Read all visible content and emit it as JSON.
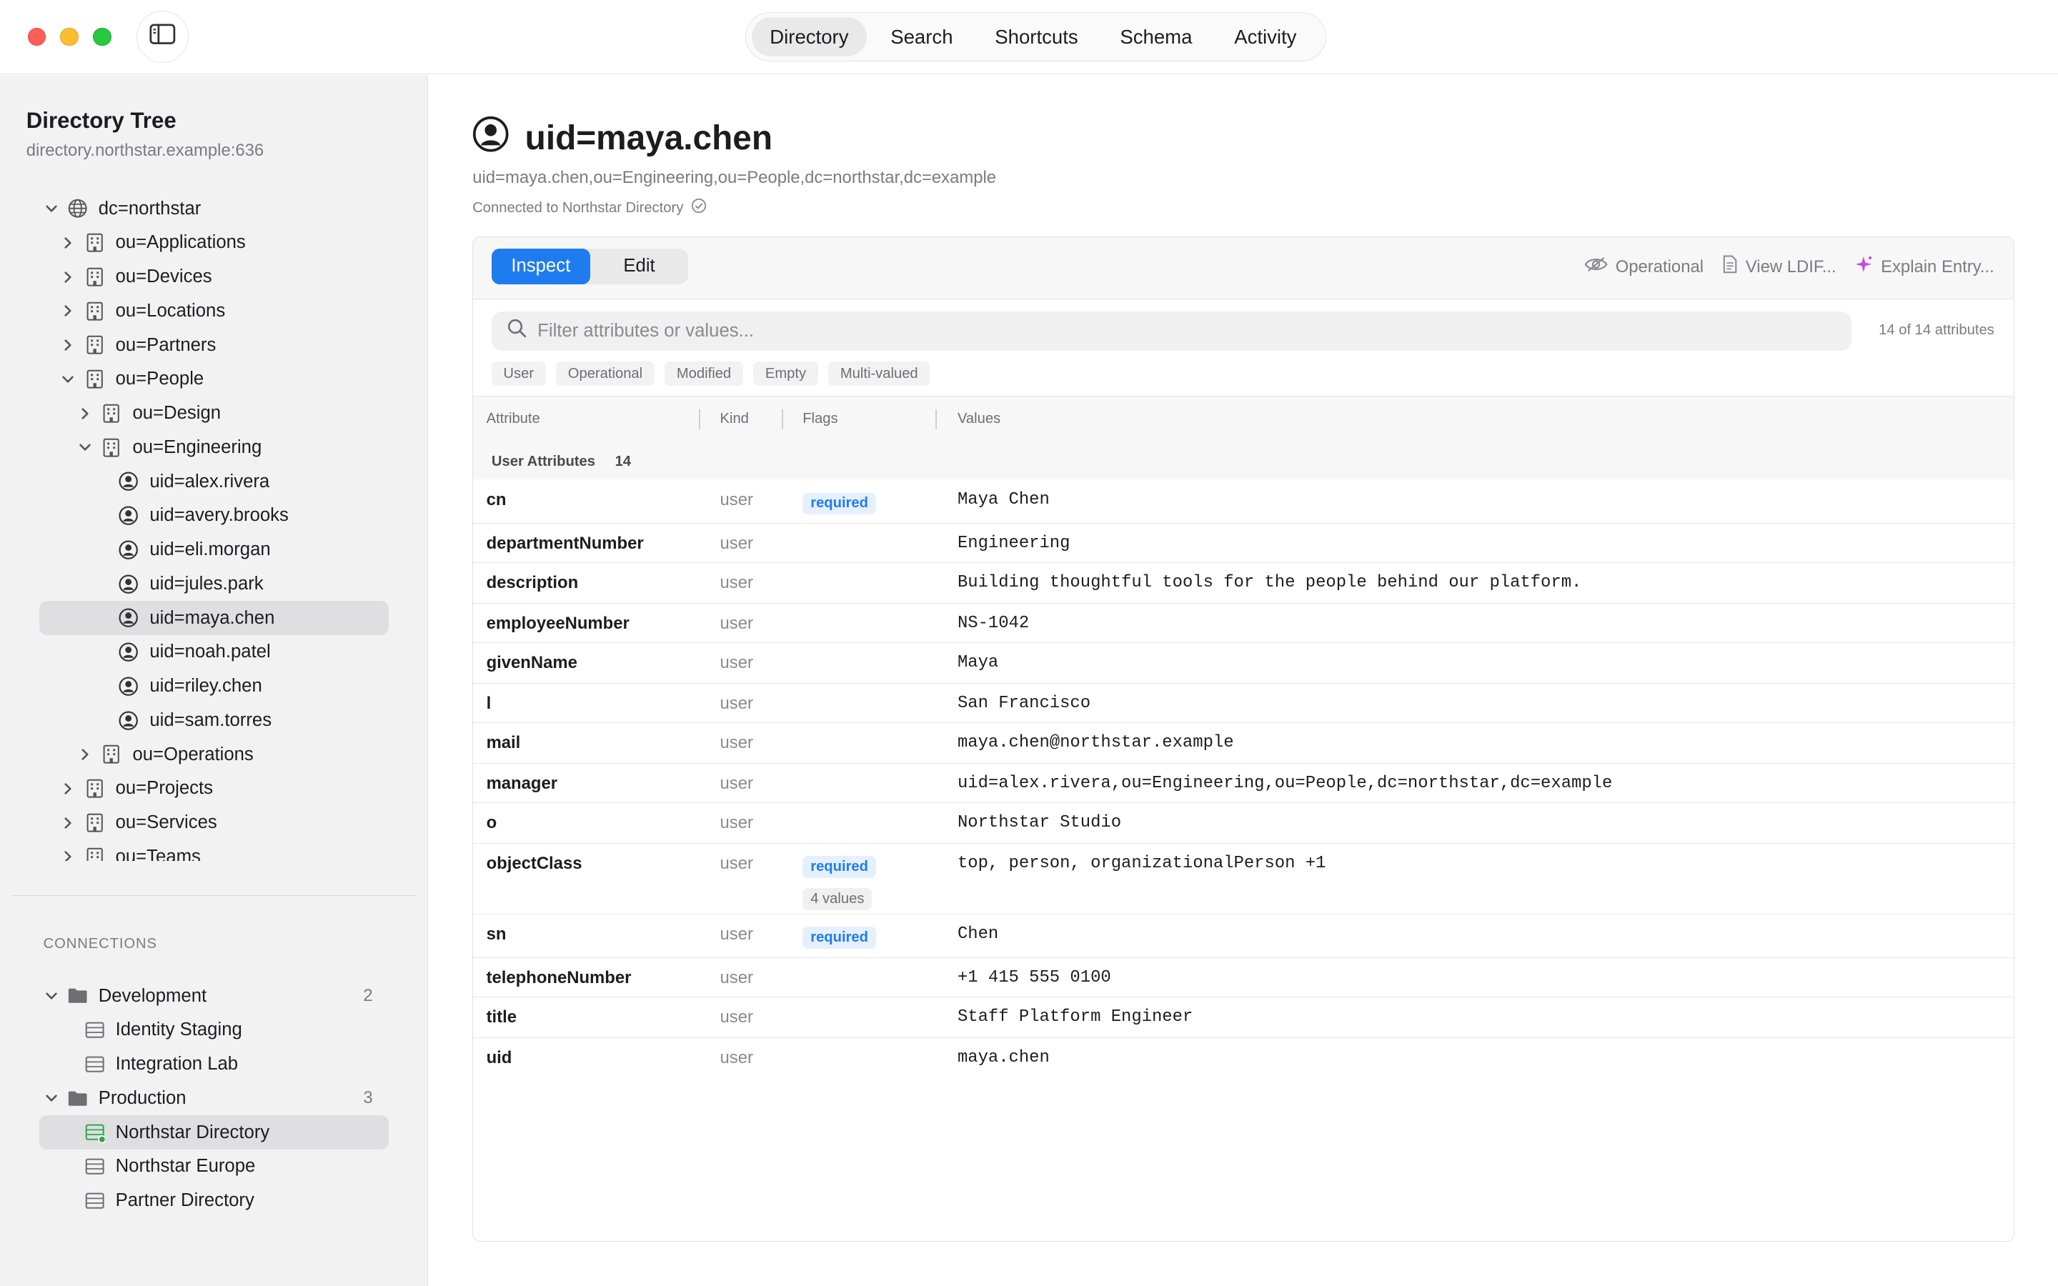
{
  "nav": {
    "tabs": [
      "Directory",
      "Search",
      "Shortcuts",
      "Schema",
      "Activity"
    ],
    "active": "Directory"
  },
  "sidebar": {
    "title": "Directory Tree",
    "host": "directory.northstar.example:636",
    "tree": [
      {
        "label": "dc=northstar",
        "depth": 0,
        "expand": "open",
        "icon": "globe-icon"
      },
      {
        "label": "ou=Applications",
        "depth": 1,
        "expand": "closed",
        "icon": "building-icon"
      },
      {
        "label": "ou=Devices",
        "depth": 1,
        "expand": "closed",
        "icon": "building-icon"
      },
      {
        "label": "ou=Locations",
        "depth": 1,
        "expand": "closed",
        "icon": "building-icon"
      },
      {
        "label": "ou=Partners",
        "depth": 1,
        "expand": "closed",
        "icon": "building-icon"
      },
      {
        "label": "ou=People",
        "depth": 1,
        "expand": "open",
        "icon": "building-icon"
      },
      {
        "label": "ou=Design",
        "depth": 2,
        "expand": "closed",
        "icon": "building-icon"
      },
      {
        "label": "ou=Engineering",
        "depth": 2,
        "expand": "open",
        "icon": "building-icon"
      },
      {
        "label": "uid=alex.rivera",
        "depth": 3,
        "expand": "none",
        "icon": "person-icon"
      },
      {
        "label": "uid=avery.brooks",
        "depth": 3,
        "expand": "none",
        "icon": "person-icon"
      },
      {
        "label": "uid=eli.morgan",
        "depth": 3,
        "expand": "none",
        "icon": "person-icon"
      },
      {
        "label": "uid=jules.park",
        "depth": 3,
        "expand": "none",
        "icon": "person-icon"
      },
      {
        "label": "uid=maya.chen",
        "depth": 3,
        "expand": "none",
        "icon": "person-icon",
        "selected": true
      },
      {
        "label": "uid=noah.patel",
        "depth": 3,
        "expand": "none",
        "icon": "person-icon"
      },
      {
        "label": "uid=riley.chen",
        "depth": 3,
        "expand": "none",
        "icon": "person-icon"
      },
      {
        "label": "uid=sam.torres",
        "depth": 3,
        "expand": "none",
        "icon": "person-icon"
      },
      {
        "label": "ou=Operations",
        "depth": 2,
        "expand": "closed",
        "icon": "building-icon"
      },
      {
        "label": "ou=Projects",
        "depth": 1,
        "expand": "closed",
        "icon": "building-icon"
      },
      {
        "label": "ou=Services",
        "depth": 1,
        "expand": "closed",
        "icon": "building-icon"
      },
      {
        "label": "ou=Teams",
        "depth": 1,
        "expand": "closed",
        "icon": "building-icon"
      }
    ],
    "connections_heading": "CONNECTIONS",
    "connections": [
      {
        "label": "Development",
        "type": "folder",
        "count": "2"
      },
      {
        "label": "Identity Staging",
        "type": "server"
      },
      {
        "label": "Integration Lab",
        "type": "server"
      },
      {
        "label": "Production",
        "type": "folder",
        "count": "3"
      },
      {
        "label": "Northstar Directory",
        "type": "server",
        "selected": true,
        "connected": true
      },
      {
        "label": "Northstar Europe",
        "type": "server"
      },
      {
        "label": "Partner Directory",
        "type": "server"
      }
    ]
  },
  "entry": {
    "title": "uid=maya.chen",
    "dn": "uid=maya.chen,ou=Engineering,ou=People,dc=northstar,dc=example",
    "connection_status": "Connected to Northstar Directory"
  },
  "panel": {
    "modes": [
      "Inspect",
      "Edit"
    ],
    "active_mode": "Inspect",
    "actions": [
      {
        "label": "Operational",
        "icon": "eye-slash-icon"
      },
      {
        "label": "View LDIF...",
        "icon": "document-icon"
      },
      {
        "label": "Explain Entry...",
        "icon": "sparkle-icon"
      }
    ],
    "search_placeholder": "Filter attributes or values...",
    "attr_count": "14 of 14 attributes",
    "filters": [
      "User",
      "Operational",
      "Modified",
      "Empty",
      "Multi-valued"
    ],
    "columns": [
      "Attribute",
      "Kind",
      "Flags",
      "Values"
    ],
    "group": {
      "label": "User Attributes",
      "count": "14"
    },
    "rows": [
      {
        "attr": "cn",
        "kind": "user",
        "flags": [
          "required"
        ],
        "value": "Maya Chen"
      },
      {
        "attr": "departmentNumber",
        "kind": "user",
        "flags": [],
        "value": "Engineering"
      },
      {
        "attr": "description",
        "kind": "user",
        "flags": [],
        "value": "Building thoughtful tools for the people behind our platform."
      },
      {
        "attr": "employeeNumber",
        "kind": "user",
        "flags": [],
        "value": "NS-1042"
      },
      {
        "attr": "givenName",
        "kind": "user",
        "flags": [],
        "value": "Maya"
      },
      {
        "attr": "l",
        "kind": "user",
        "flags": [],
        "value": "San Francisco"
      },
      {
        "attr": "mail",
        "kind": "user",
        "flags": [],
        "value": "maya.chen@northstar.example"
      },
      {
        "attr": "manager",
        "kind": "user",
        "flags": [],
        "value": "uid=alex.rivera,ou=Engineering,ou=People,dc=northstar,dc=example"
      },
      {
        "attr": "o",
        "kind": "user",
        "flags": [],
        "value": "Northstar Studio"
      },
      {
        "attr": "objectClass",
        "kind": "user",
        "flags": [
          "required",
          "4 values"
        ],
        "value": "top, person, organizationalPerson +1"
      },
      {
        "attr": "sn",
        "kind": "user",
        "flags": [
          "required"
        ],
        "value": "Chen"
      },
      {
        "attr": "telephoneNumber",
        "kind": "user",
        "flags": [],
        "value": "+1 415 555 0100"
      },
      {
        "attr": "title",
        "kind": "user",
        "flags": [],
        "value": "Staff Platform Engineer"
      },
      {
        "attr": "uid",
        "kind": "user",
        "flags": [],
        "value": "maya.chen"
      }
    ]
  },
  "colors": {
    "accent": "#1f7cf0",
    "selection": "#dfdfe1",
    "connected_dot": "#2fa84f"
  }
}
